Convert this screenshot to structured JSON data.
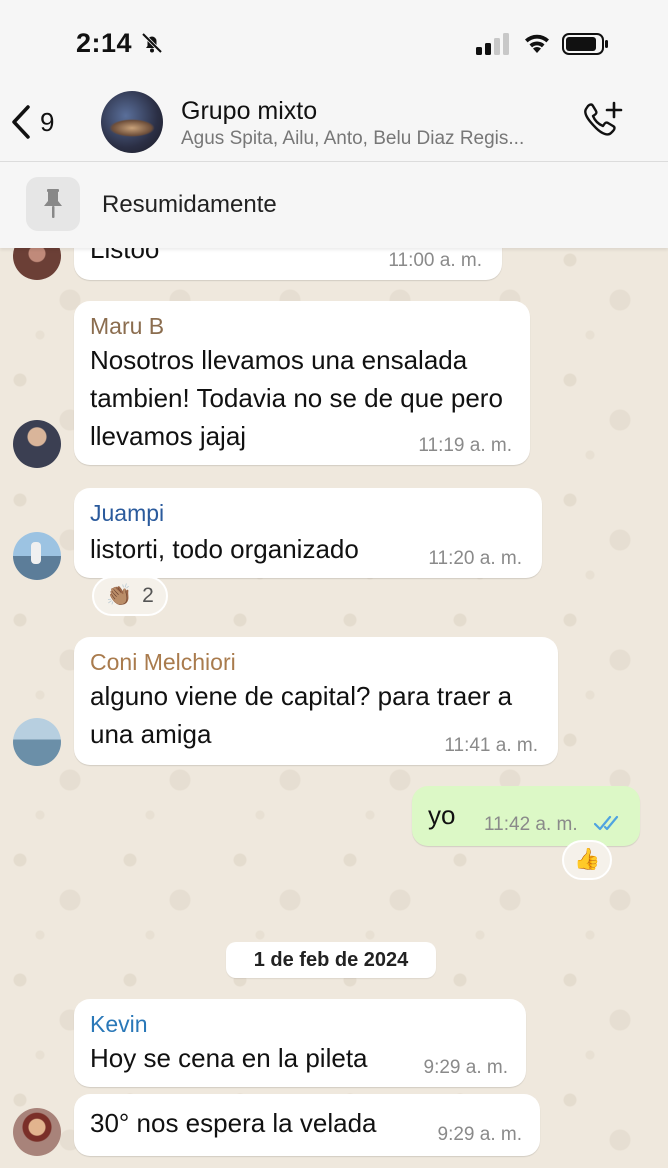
{
  "status_bar": {
    "time": "2:14"
  },
  "header": {
    "back_count": "9",
    "group_name": "Grupo mixto",
    "members": "Agus Spita, Ailu, Anto, Belu Diaz Regis..."
  },
  "pinned": {
    "text": "Resumidamente"
  },
  "messages": [
    {
      "text": "Listoo",
      "time": "11:00 a. m."
    },
    {
      "sender": "Maru B",
      "sender_color": "#8b6d4f",
      "text": "Nosotros llevamos una ensalada tambien! Todavia no se de que pero llevamos jajaj",
      "time": "11:19 a. m."
    },
    {
      "sender": "Juampi",
      "sender_color": "#2a5a9c",
      "text": "listorti, todo organizado",
      "time": "11:20 a. m.",
      "reaction": {
        "emoji": "👏🏽",
        "count": "2"
      }
    },
    {
      "sender": "Coni Melchiori",
      "sender_color": "#a97b4d",
      "text": "alguno viene de capital? para traer a una amiga",
      "time": "11:41 a. m."
    },
    {
      "outgoing": true,
      "text": "yo",
      "time": "11:42 a. m.",
      "reaction": {
        "emoji": "👍"
      }
    },
    {
      "sender": "Kevin",
      "sender_color": "#2a78b8",
      "text": "Hoy se cena en la pileta",
      "time": "9:29 a. m."
    },
    {
      "text": "30° nos espera la velada",
      "time": "9:29 a. m."
    }
  ],
  "date_separator": "1 de feb de 2024",
  "colors": {
    "outgoing_bubble": "#dcf8c6",
    "read_ticks": "#4fa3e0"
  }
}
